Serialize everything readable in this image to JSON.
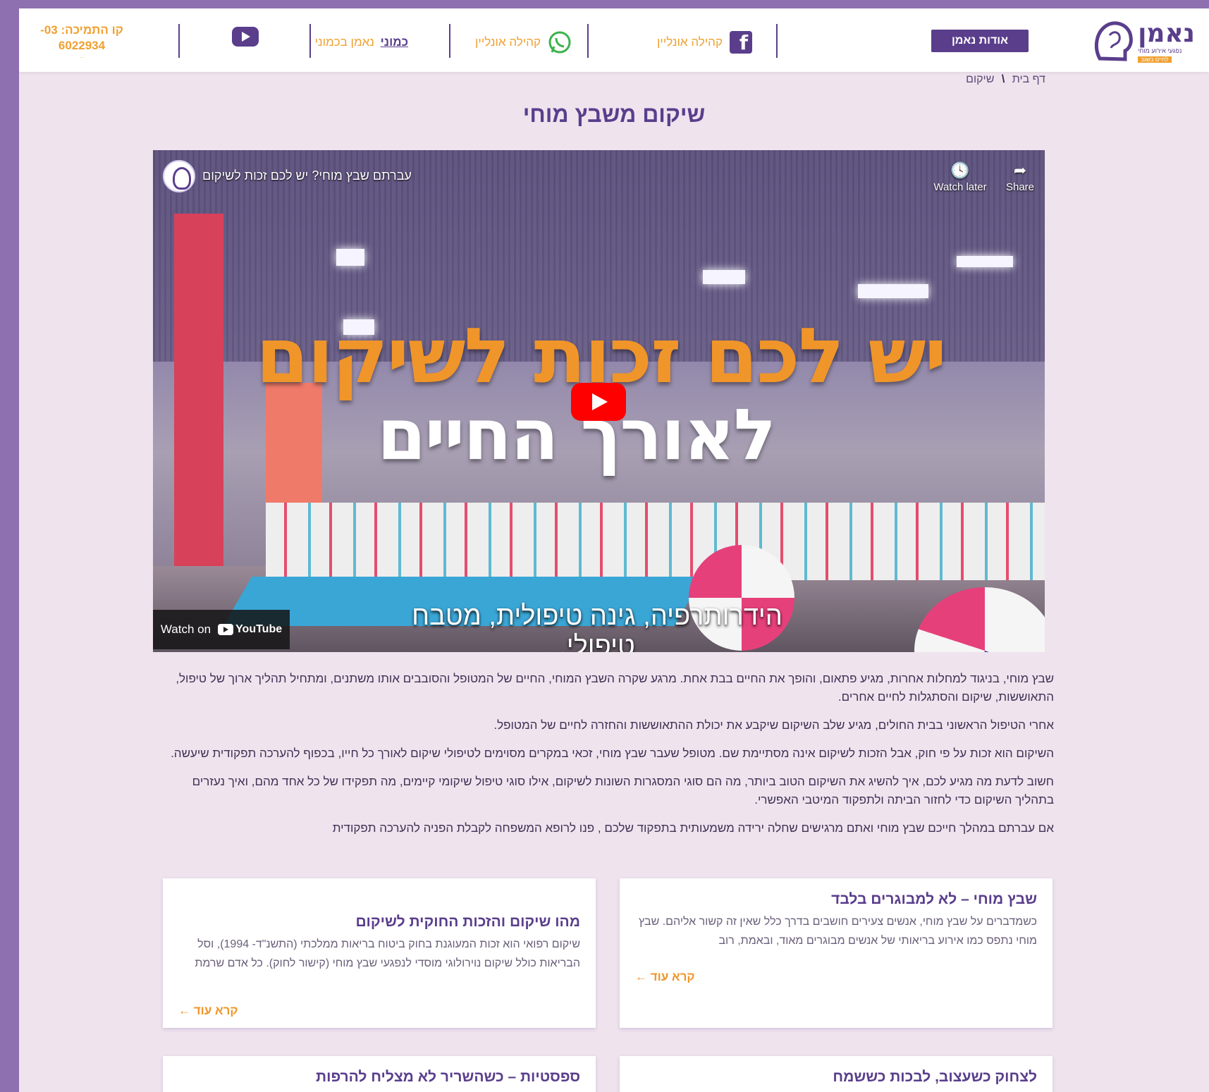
{
  "header": {
    "logo_name": "נאמן",
    "logo_sub": "נפגעי אירוע מוחי",
    "logo_tag": "לחיים בשגב",
    "about_label": "אודות נאמן",
    "facebook_label": "קהילה אונליין",
    "whatsapp_label": "קהילה אונליין",
    "nv_prefix": "כמוני",
    "nv_label": "נאמן בכמוני",
    "support_line1": "קו התמיכה: 03-",
    "support_line2": "6022934",
    "support_small": "..."
  },
  "breadcrumb": {
    "home": "דף בית",
    "separator": "\\",
    "current": "שיקום"
  },
  "page": {
    "title": "שיקום משבץ מוחי"
  },
  "video": {
    "title": "עברתם שבץ מוחי? יש לכם זכות לשיקום",
    "watch_later": "Watch later",
    "share": "Share",
    "headline_1": "יש לכם זכות לשיקום",
    "headline_2": "לאורך החיים",
    "caption": "הידרותרפיה, גינה טיפולית, מטבח טיפולי.",
    "watch_on": "Watch on",
    "youtube": "YouTube"
  },
  "content": {
    "p1": "שבץ מוחי, בניגוד למחלות אחרות, מגיע פתאום, והופך את החיים בבת אחת. מרגע שקרה השבץ המוחי, החיים של המטופל והסובבים אותו משתנים, ומתחיל תהליך ארוך של טיפול, התאוששות, שיקום והסתגלות לחיים אחרים.",
    "p2": "אחרי הטיפול הראשוני בבית החולים, מגיע שלב השיקום שיקבע את יכולת ההתאוששות והחזרה לחיים של המטופל.",
    "p3": "השיקום הוא זכות על פי חוק, אבל הזכות לשיקום אינה מסתיימת שם. מטופל שעבר שבץ מוחי, זכאי במקרים מסוימים לטיפולי שיקום לאורך כל חייו, בכפוף להערכה תפקודית שיעשה.",
    "p4": "חשוב לדעת מה מגיע לכם, איך להשיג את השיקום הטוב ביותר, מה הם סוגי המסגרות השונות לשיקום, אילו סוגי טיפול שיקומי קיימים, מה תפקידו של כל אחד מהם, ואיך נעזרים בתהליך השיקום כדי לחזור הביתה ולתפקוד המיטבי האפשרי.",
    "p5": "אם עברתם במהלך חייכם שבץ מוחי ואתם מרגישים שחלה ירידה משמעותית בתפקוד שלכם , פנו לרופא המשפחה לקבלת הפניה להערכה תפקודית"
  },
  "cards": [
    {
      "title": "שבץ מוחי – לא למבוגרים בלבד",
      "text": "כשמדברים על שבץ מוחי, אנשים צעירים חושבים בדרך כלל שאין זה קשור אליהם. שבץ מוחי נתפס כמו אירוע בריאותי של אנשים מבוגרים מאוד, ובאמת, רוב",
      "more": "קרא עוד ←"
    },
    {
      "title": "מהו שיקום והזכות החוקית לשיקום",
      "text": "שיקום רפואי הוא זכות המעוגנת בחוק ביטוח בריאות ממלכתי (התשנ\"ד- 1994), וסל הבריאות כולל שיקום נוירולוגי מוסדי לנפגעי שבץ מוחי (קישור לחוק). כל אדם שרמת",
      "more": "קרא עוד ←"
    },
    {
      "title": "לצחוק כשעצוב, לבכות כששמח",
      "text": "",
      "more": ""
    },
    {
      "title": "ספסטיות – כשהשריר לא מצליח להרפות",
      "text": "",
      "more": ""
    }
  ],
  "colors": {
    "brand": "#5a3e8c",
    "accent": "#f0952a",
    "frame": "#8e6fb0",
    "page_bg": "#efe3ee"
  }
}
